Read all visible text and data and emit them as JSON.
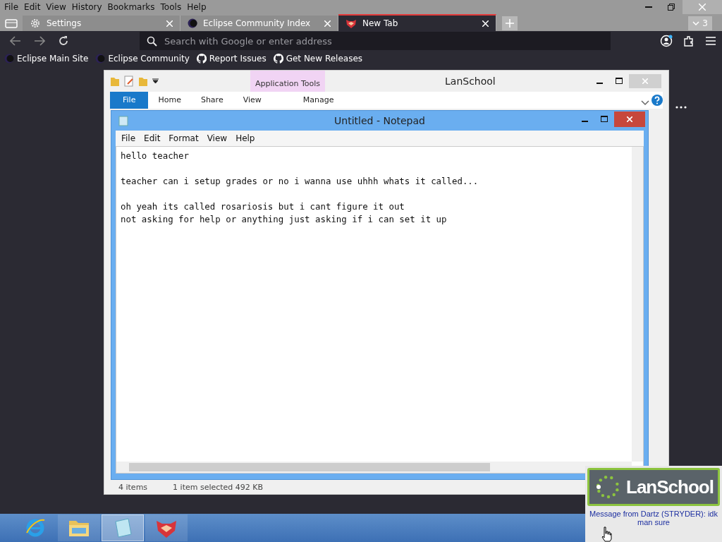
{
  "browser": {
    "menu": [
      "File",
      "Edit",
      "View",
      "History",
      "Bookmarks",
      "Tools",
      "Help"
    ],
    "tabs": [
      {
        "title": "Settings",
        "kind": "settings",
        "selected": false
      },
      {
        "title": "Eclipse Community Index",
        "kind": "eclipse",
        "selected": false
      },
      {
        "title": "New Tab",
        "kind": "fox",
        "selected": true
      }
    ],
    "tab_count": "3",
    "address": {
      "placeholder": "Search with Google or enter address"
    },
    "bookmarks": [
      {
        "label": "Eclipse Main Site",
        "kind": "eclipse"
      },
      {
        "label": "Eclipse Community",
        "kind": "eclipse"
      },
      {
        "label": "Report Issues",
        "kind": "github"
      },
      {
        "label": "Get New Releases",
        "kind": "github"
      }
    ]
  },
  "explorer": {
    "title": "LanSchool",
    "context_group": "Application Tools",
    "ribbon_tabs": [
      {
        "label": "File",
        "selected": true
      },
      {
        "label": "Home",
        "selected": false
      },
      {
        "label": "Share",
        "selected": false
      },
      {
        "label": "View",
        "selected": false
      },
      {
        "label": "Manage",
        "selected": false
      }
    ],
    "status": [
      "4 items",
      "1 item selected  492 KB"
    ]
  },
  "notepad": {
    "title": "Untitled - Notepad",
    "menu": [
      "File",
      "Edit",
      "Format",
      "View",
      "Help"
    ],
    "paragraphs": [
      [
        "hello teacher"
      ],
      [
        "teacher can i setup grades or no i wanna use uhhh whats it called..."
      ],
      [
        "oh yeah its called rosariosis but i cant figure it out",
        "not asking for help or anything just asking if i can set it up"
      ]
    ]
  },
  "taskbar": [
    {
      "kind": "ie",
      "selected": false
    },
    {
      "kind": "folder",
      "selected": false
    },
    {
      "kind": "notepad",
      "selected": true
    },
    {
      "kind": "fox",
      "selected": false
    }
  ],
  "notification": {
    "brand": "LanSchool",
    "message": "Message from Dartz (STRYDER): idk man sure"
  }
}
